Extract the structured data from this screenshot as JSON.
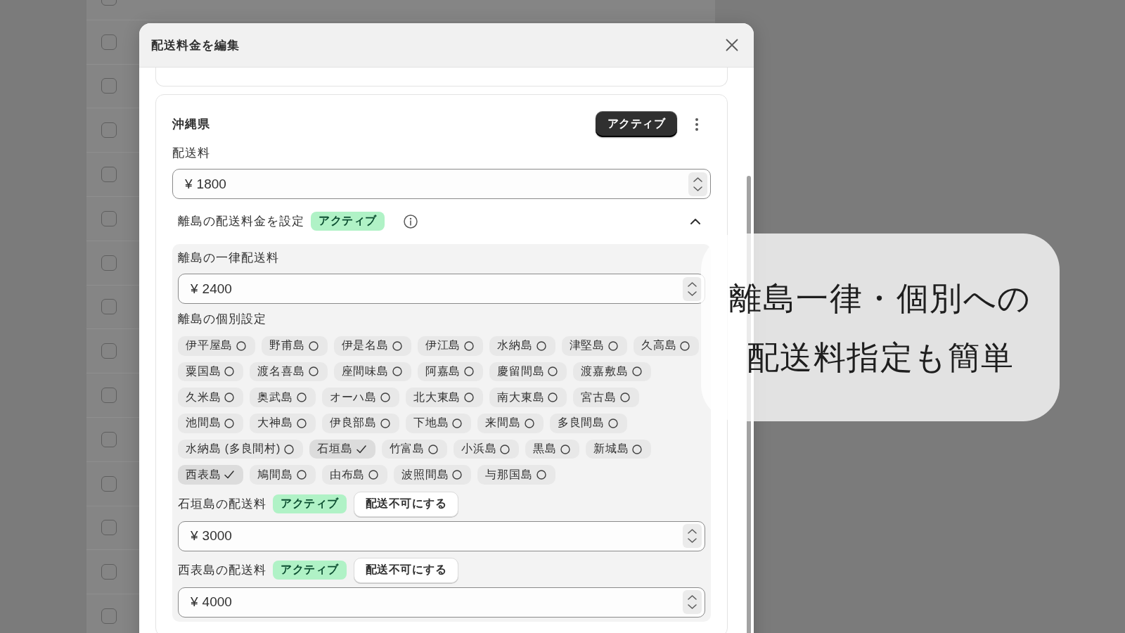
{
  "background_table": {
    "rows": [
      {
        "checked": false
      },
      {
        "checked": false
      },
      {
        "checked": false
      },
      {
        "checked": false
      },
      {
        "checked": false
      },
      {
        "checked": false
      },
      {
        "checked": false
      },
      {
        "checked": false
      },
      {
        "checked": false
      },
      {
        "checked": false
      },
      {
        "checked": false
      },
      {
        "checked": false
      },
      {
        "checked": false
      },
      {
        "checked": false
      },
      {
        "checked": false
      }
    ]
  },
  "modal": {
    "title": "配送料金を編集",
    "prefecture": {
      "name": "沖縄県",
      "status_button": "アクティブ",
      "fee_label": "配送料",
      "fee": {
        "prefix": "¥",
        "value": "1800"
      },
      "islands_section": {
        "title": "離島の配送料金を設定",
        "badge": "アクティブ",
        "expanded": true,
        "flat_fee_label": "離島の一律配送料",
        "flat_fee": {
          "prefix": "¥",
          "value": "2400"
        },
        "individual_label": "離島の個別設定",
        "islands": [
          {
            "label": "伊平屋島",
            "selected": false
          },
          {
            "label": "野甫島",
            "selected": false
          },
          {
            "label": "伊是名島",
            "selected": false
          },
          {
            "label": "伊江島",
            "selected": false
          },
          {
            "label": "水納島",
            "selected": false
          },
          {
            "label": "津堅島",
            "selected": false
          },
          {
            "label": "久高島",
            "selected": false
          },
          {
            "label": "粟国島",
            "selected": false
          },
          {
            "label": "渡名喜島",
            "selected": false
          },
          {
            "label": "座間味島",
            "selected": false
          },
          {
            "label": "阿嘉島",
            "selected": false
          },
          {
            "label": "慶留間島",
            "selected": false
          },
          {
            "label": "渡嘉敷島",
            "selected": false
          },
          {
            "label": "久米島",
            "selected": false
          },
          {
            "label": "奥武島",
            "selected": false
          },
          {
            "label": "オーハ島",
            "selected": false
          },
          {
            "label": "北大東島",
            "selected": false
          },
          {
            "label": "南大東島",
            "selected": false
          },
          {
            "label": "宮古島",
            "selected": false
          },
          {
            "label": "池間島",
            "selected": false
          },
          {
            "label": "大神島",
            "selected": false
          },
          {
            "label": "伊良部島",
            "selected": false
          },
          {
            "label": "下地島",
            "selected": false
          },
          {
            "label": "来間島",
            "selected": false
          },
          {
            "label": "多良間島",
            "selected": false
          },
          {
            "label": "水納島 (多良間村)",
            "selected": false
          },
          {
            "label": "石垣島",
            "selected": true
          },
          {
            "label": "竹富島",
            "selected": false
          },
          {
            "label": "小浜島",
            "selected": false
          },
          {
            "label": "黒島",
            "selected": false
          },
          {
            "label": "新城島",
            "selected": false
          },
          {
            "label": "西表島",
            "selected": true
          },
          {
            "label": "鳩間島",
            "selected": false
          },
          {
            "label": "由布島",
            "selected": false
          },
          {
            "label": "波照間島",
            "selected": false
          },
          {
            "label": "与那国島",
            "selected": false
          }
        ],
        "island_fees": [
          {
            "label": "石垣島の配送料",
            "badge": "アクティブ",
            "button": "配送不可にする",
            "fee": {
              "prefix": "¥",
              "value": "3000"
            }
          },
          {
            "label": "西表島の配送料",
            "badge": "アクティブ",
            "button": "配送不可にする",
            "fee": {
              "prefix": "¥",
              "value": "4000"
            }
          }
        ]
      }
    }
  },
  "callout": {
    "lines": [
      "離島一律・個別への",
      "配送料指定も簡単"
    ]
  }
}
